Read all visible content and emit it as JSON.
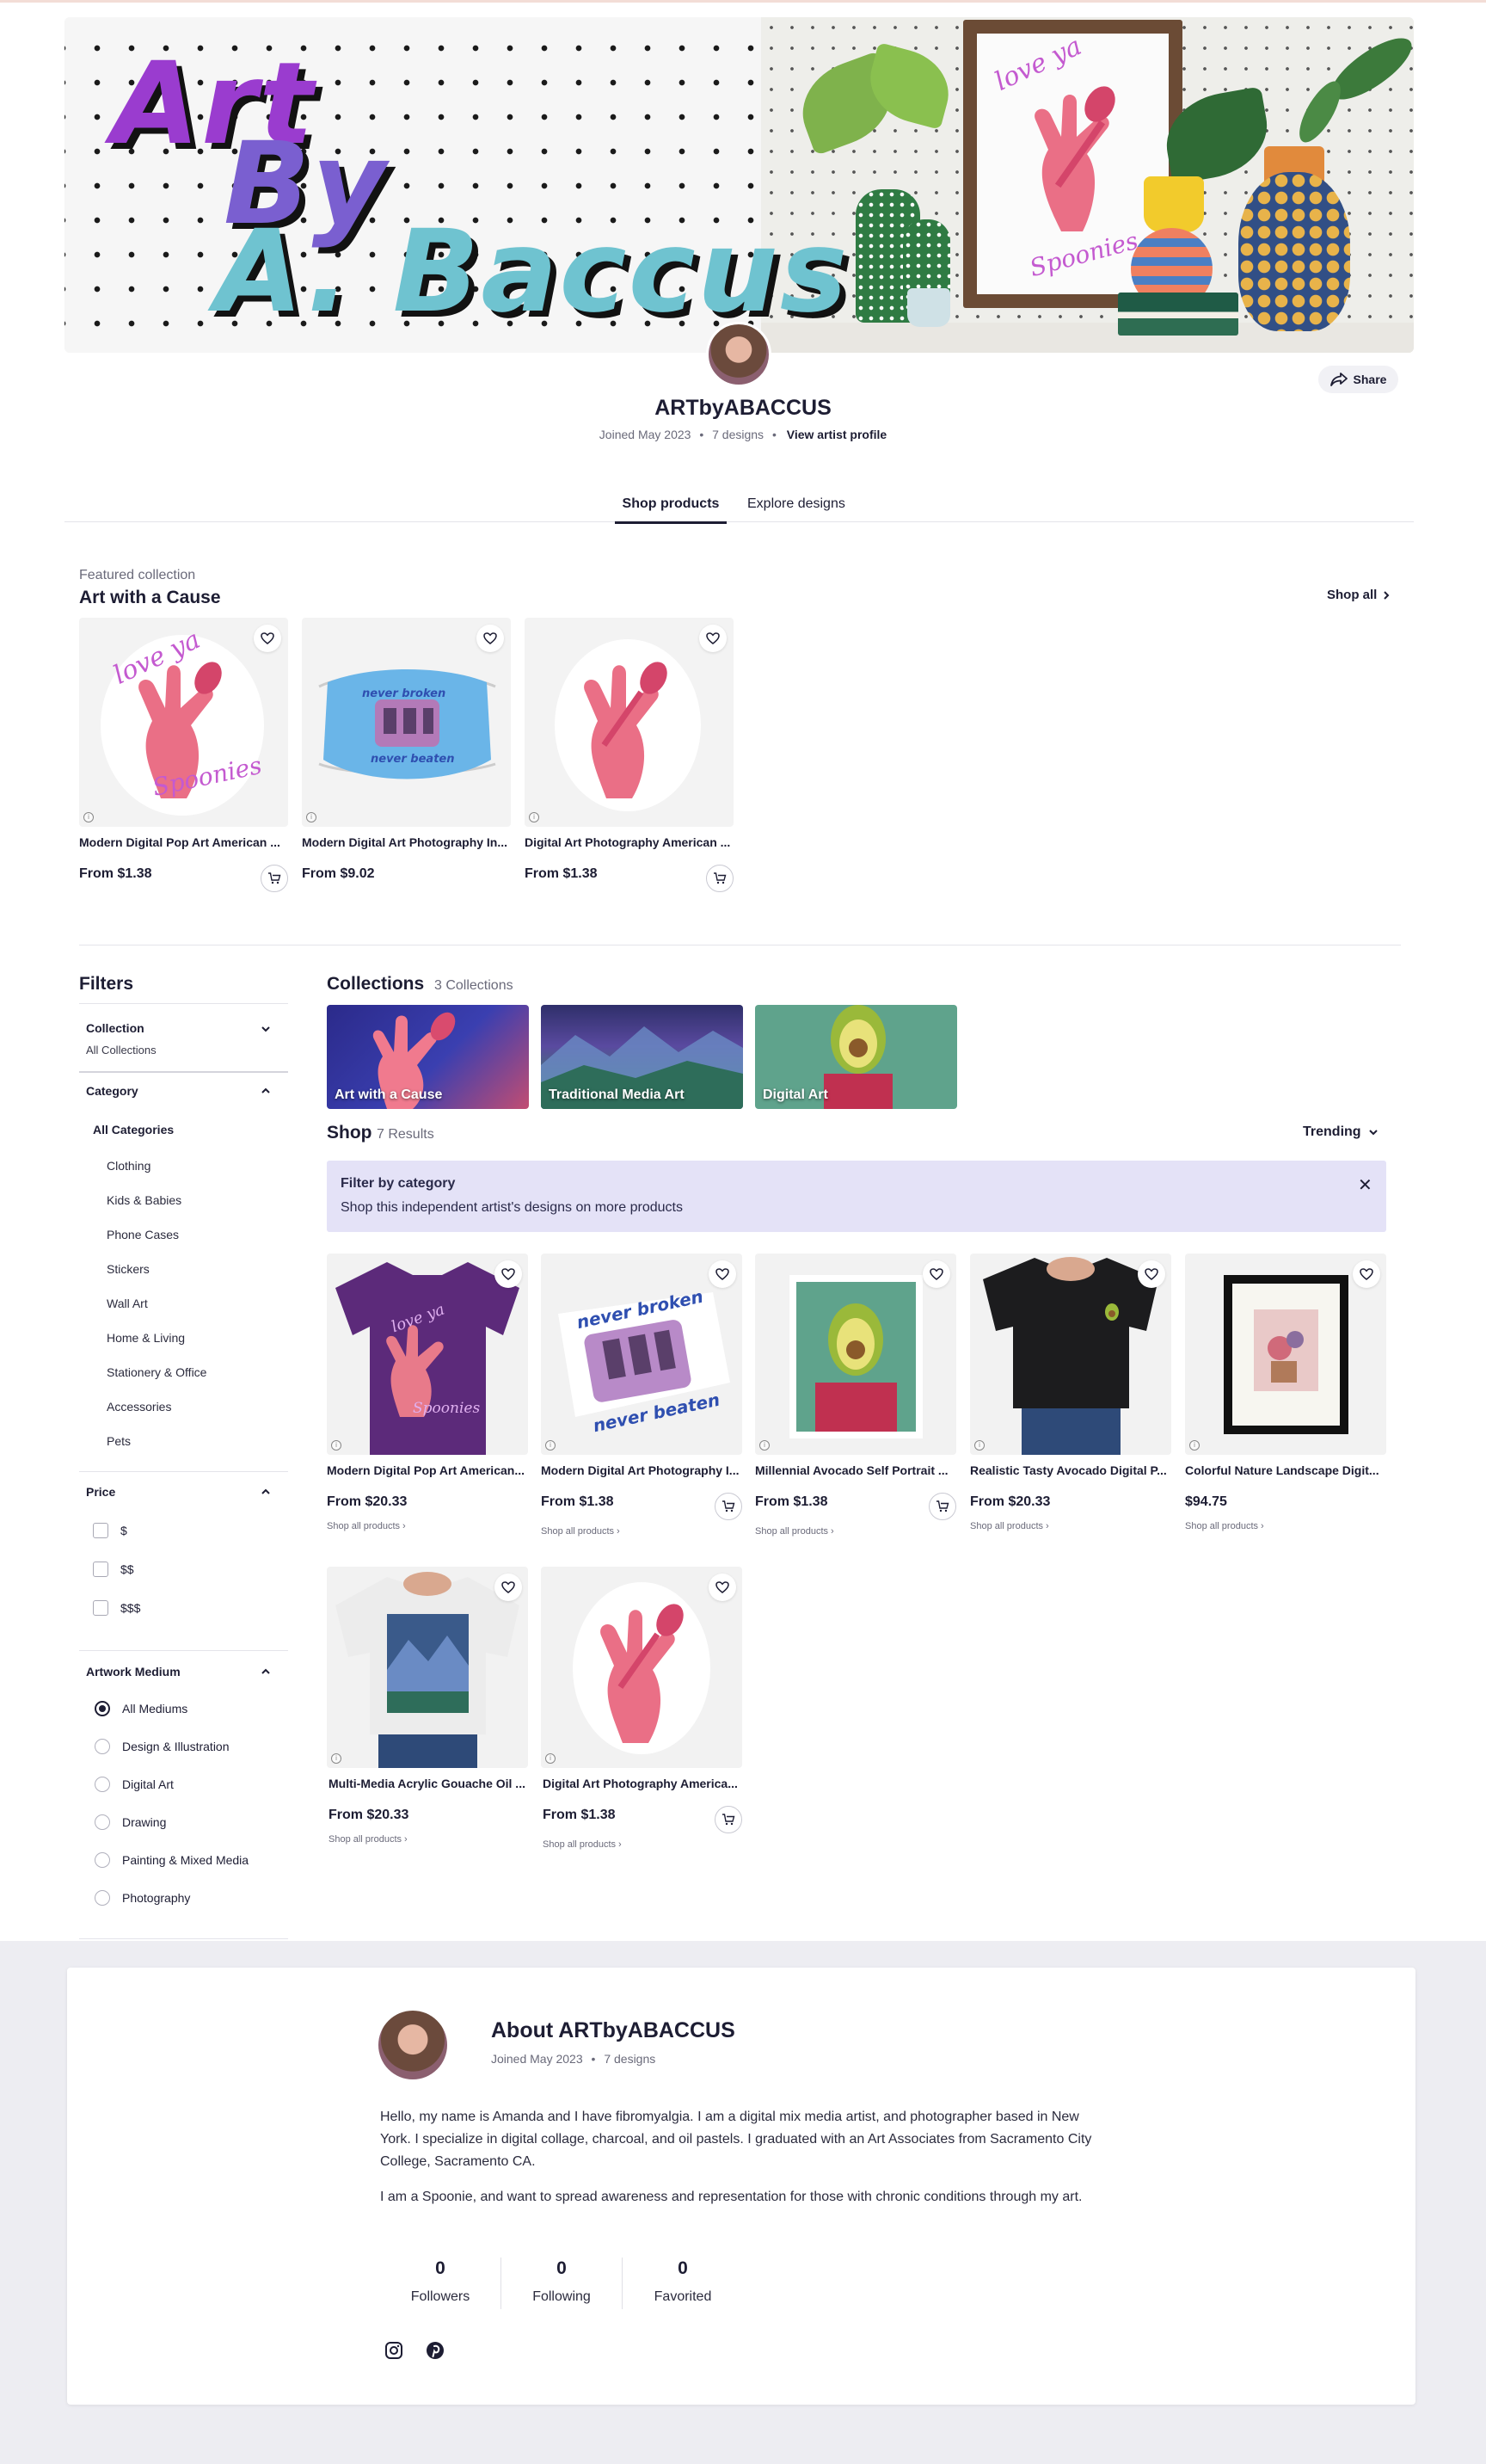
{
  "banner": {
    "logo_lines": [
      "Art",
      "By",
      "A. Baccus"
    ],
    "frame_text_top": "love ya",
    "frame_text_bottom": "Spoonies"
  },
  "profile": {
    "name": "ARTbyABACCUS",
    "joined": "Joined May 2023",
    "designs": "7 designs",
    "view_profile": "View artist profile",
    "share_label": "Share"
  },
  "tabs": [
    {
      "label": "Shop products",
      "active": true
    },
    {
      "label": "Explore designs",
      "active": false
    }
  ],
  "featured": {
    "eyebrow": "Featured collection",
    "title": "Art with a Cause",
    "shop_all": "Shop all",
    "products": [
      {
        "title": "Modern Digital Pop Art American ...",
        "price": "From $1.38"
      },
      {
        "title": "Modern Digital Art Photography In...",
        "price": "From $9.02"
      },
      {
        "title": "Digital Art Photography American ...",
        "price": "From $1.38"
      }
    ]
  },
  "filters": {
    "title": "Filters",
    "collection": {
      "label": "Collection",
      "value": "All Collections"
    },
    "category": {
      "label": "Category",
      "all": "All Categories",
      "items": [
        "Clothing",
        "Kids & Babies",
        "Phone Cases",
        "Stickers",
        "Wall Art",
        "Home & Living",
        "Stationery & Office",
        "Accessories",
        "Pets"
      ]
    },
    "price": {
      "label": "Price",
      "options": [
        "$",
        "$$",
        "$$$"
      ]
    },
    "medium": {
      "label": "Artwork Medium",
      "options": [
        "All Mediums",
        "Design & Illustration",
        "Digital Art",
        "Drawing",
        "Painting & Mixed Media",
        "Photography"
      ],
      "selected": "All Mediums"
    }
  },
  "collections": {
    "title": "Collections",
    "count": "3 Collections",
    "items": [
      "Art with a Cause",
      "Traditional Media Art",
      "Digital Art"
    ]
  },
  "shop": {
    "title": "Shop",
    "count": "7 Results",
    "sort": "Trending",
    "category_box": {
      "title": "Filter by category",
      "text": "Shop this independent artist's designs on more products"
    },
    "shop_all_products": "Shop all products",
    "products": [
      {
        "title": "Modern Digital Pop Art American...",
        "price": "From $20.33"
      },
      {
        "title": "Modern Digital Art Photography I...",
        "price": "From $1.38"
      },
      {
        "title": "Millennial Avocado Self Portrait ...",
        "price": "From $1.38"
      },
      {
        "title": "Realistic Tasty Avocado Digital P...",
        "price": "From $20.33"
      },
      {
        "title": "Colorful Nature Landscape Digit...",
        "price": "$94.75"
      },
      {
        "title": "Multi-Media Acrylic Gouache Oil ...",
        "price": "From $20.33"
      },
      {
        "title": "Digital Art Photography America...",
        "price": "From $1.38"
      }
    ]
  },
  "about": {
    "title": "About ARTbyABACCUS",
    "joined": "Joined May 2023",
    "designs": "7 designs",
    "p1": "Hello, my name is Amanda and I have fibromyalgia. I am a digital mix media artist, and photographer based in New York. I specialize in digital collage, charcoal, and oil pastels. I graduated with an Art Associates from Sacramento City College, Sacramento CA.",
    "p2": "I am a Spoonie, and want to spread awareness and representation for those with chronic conditions through my art.",
    "stats": [
      {
        "value": "0",
        "label": "Followers"
      },
      {
        "value": "0",
        "label": "Following"
      },
      {
        "value": "0",
        "label": "Favorited"
      }
    ]
  },
  "icons": {
    "share": "share-arrow-icon",
    "heart": "heart-icon",
    "cart": "add-to-cart-icon",
    "chevron": "chevron-icon",
    "close": "close-icon",
    "instagram": "instagram-icon",
    "pinterest": "pinterest-icon"
  }
}
